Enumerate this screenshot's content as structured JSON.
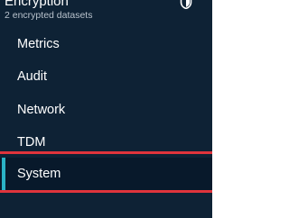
{
  "sidebar": {
    "encryption": {
      "title": "Encryption",
      "subtitle": "2 encrypted datasets",
      "icon": "shield-icon"
    },
    "items": [
      {
        "label": "Metrics"
      },
      {
        "label": "Audit"
      },
      {
        "label": "Network"
      },
      {
        "label": "TDM"
      },
      {
        "label": "System",
        "selected": true
      }
    ]
  },
  "colors": {
    "sidebar_bg": "#0e2235",
    "selected_bg": "#08192b",
    "selected_accent": "#2bb3c7",
    "highlight": "#e0343c",
    "text": "#ffffff",
    "subtext": "#b8c2cc"
  }
}
